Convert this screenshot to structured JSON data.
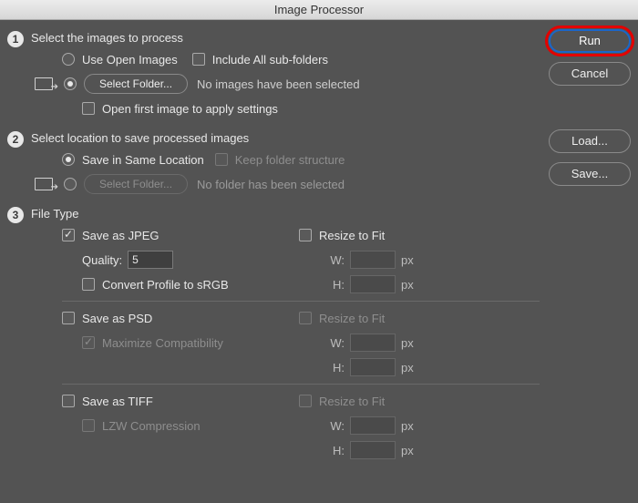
{
  "window": {
    "title": "Image Processor"
  },
  "buttons": {
    "run": "Run",
    "cancel": "Cancel",
    "load": "Load...",
    "save": "Save..."
  },
  "step1": {
    "title": "Select the images to process",
    "use_open_images": "Use Open Images",
    "include_subfolders": "Include All sub-folders",
    "select_folder": "Select Folder...",
    "no_images_note": "No images have been selected",
    "open_first_image": "Open first image to apply settings"
  },
  "step2": {
    "title": "Select location to save processed images",
    "save_same_location": "Save in Same Location",
    "keep_folder_structure": "Keep folder structure",
    "select_folder": "Select Folder...",
    "no_folder_note": "No folder has been selected"
  },
  "step3": {
    "title": "File Type",
    "jpeg": {
      "label": "Save as JPEG",
      "quality_label": "Quality:",
      "quality_value": "5",
      "convert_srgb": "Convert Profile to sRGB",
      "resize_label": "Resize to Fit",
      "w_label": "W:",
      "h_label": "H:",
      "unit": "px"
    },
    "psd": {
      "label": "Save as PSD",
      "max_compat": "Maximize Compatibility",
      "resize_label": "Resize to Fit",
      "w_label": "W:",
      "h_label": "H:",
      "unit": "px"
    },
    "tiff": {
      "label": "Save as TIFF",
      "lzw": "LZW Compression",
      "resize_label": "Resize to Fit",
      "w_label": "W:",
      "h_label": "H:",
      "unit": "px"
    }
  }
}
